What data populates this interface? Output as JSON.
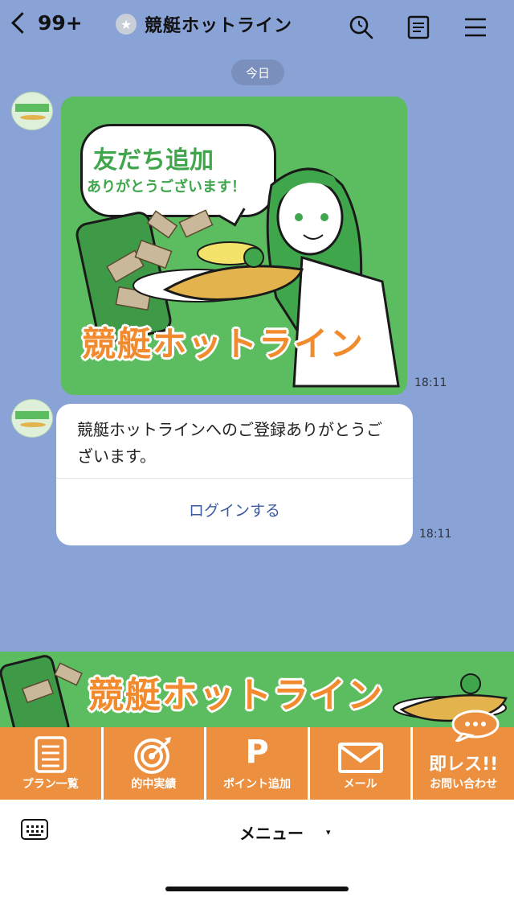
{
  "header": {
    "unread_count": "99+",
    "title": "競艇ホットライン"
  },
  "date_chip": "今日",
  "messages": [
    {
      "type": "image",
      "speech_line1": "友だち追加",
      "speech_line2": "ありがとうございます！",
      "logo_text": "競艇ホットライン",
      "time": "18:11"
    },
    {
      "type": "text",
      "body": "競艇ホットラインへのご登録ありがとうございます。",
      "action_label": "ログインする",
      "time": "18:11"
    }
  ],
  "rich_menu": {
    "banner_logo": "競艇ホットライン",
    "buttons": [
      {
        "label": "プラン一覧",
        "icon": "list-icon"
      },
      {
        "label": "的中実績",
        "icon": "target-icon"
      },
      {
        "label": "ポイント追加",
        "icon": "points-icon",
        "glyph": "P"
      },
      {
        "label": "メール",
        "icon": "mail-icon"
      },
      {
        "label": "お問い合わせ",
        "icon": "chat-bubble-icon",
        "headline": "即レス!!"
      }
    ]
  },
  "bottom_bar": {
    "menu_label": "メニュー",
    "caret": "▾"
  },
  "colors": {
    "chat_bg": "#8aa3d6",
    "brand_green": "#5cbd60",
    "brand_orange": "#ec8f3f",
    "link": "#3a5aa0"
  }
}
